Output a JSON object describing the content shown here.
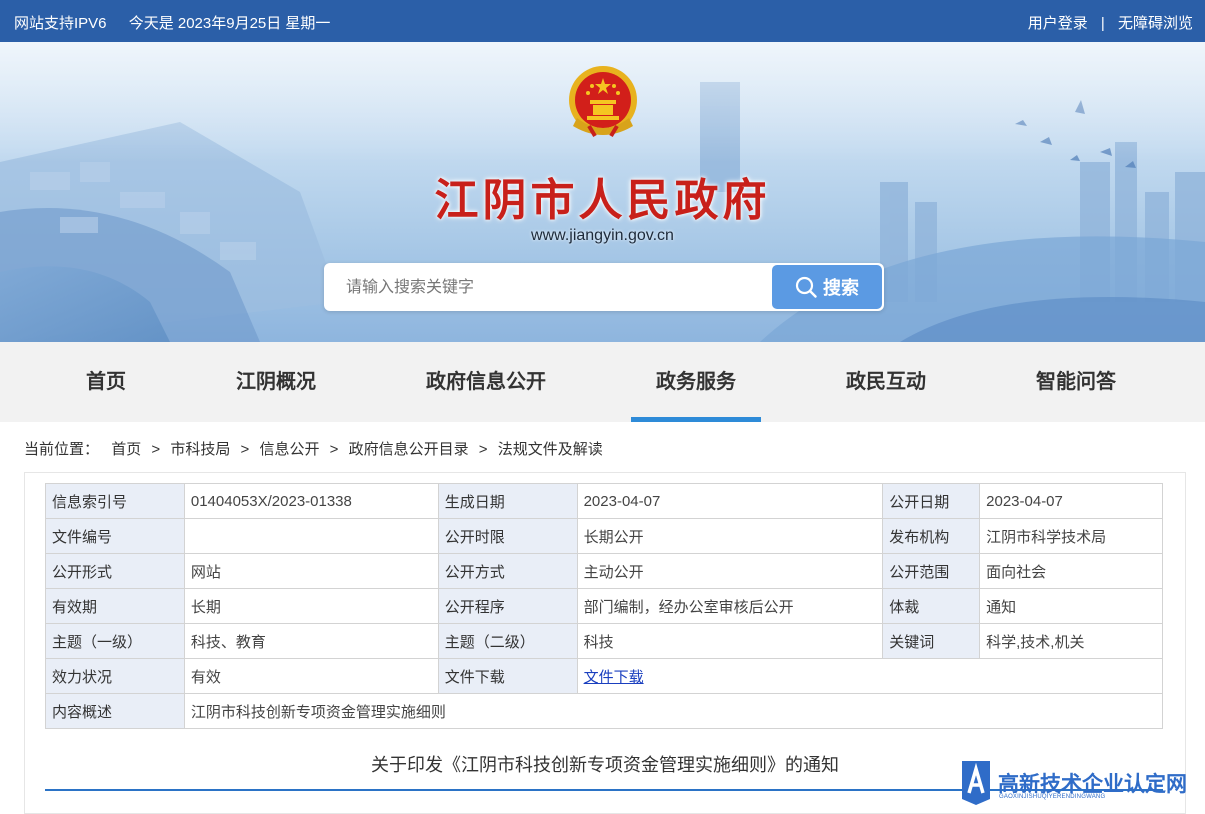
{
  "topbar": {
    "ipv6": "网站支持IPV6",
    "date": "今天是 2023年9月25日 星期一",
    "login": "用户登录",
    "separator": "|",
    "accessibility": "无障碍浏览"
  },
  "header": {
    "title": "江阴市人民政府",
    "url": "www.jiangyin.gov.cn"
  },
  "search": {
    "placeholder": "请输入搜索关键字",
    "button": "搜索"
  },
  "nav": [
    {
      "label": "首页"
    },
    {
      "label": "江阴概况"
    },
    {
      "label": "政府信息公开"
    },
    {
      "label": "政务服务",
      "active": true
    },
    {
      "label": "政民互动"
    },
    {
      "label": "智能问答"
    }
  ],
  "breadcrumb": {
    "prefix": "当前位置：",
    "items": [
      "首页",
      "市科技局",
      "信息公开",
      "政府信息公开目录",
      "法规文件及解读"
    ],
    "separator": ">"
  },
  "meta": {
    "index_no": {
      "label": "信息索引号",
      "value": "01404053X/2023-01338"
    },
    "created": {
      "label": "生成日期",
      "value": "2023-04-07"
    },
    "published": {
      "label": "公开日期",
      "value": "2023-04-07"
    },
    "doc_no": {
      "label": "文件编号",
      "value": ""
    },
    "period": {
      "label": "公开时限",
      "value": "长期公开"
    },
    "issuer": {
      "label": "发布机构",
      "value": "江阴市科学技术局"
    },
    "form": {
      "label": "公开形式",
      "value": "网站"
    },
    "method": {
      "label": "公开方式",
      "value": "主动公开"
    },
    "scope": {
      "label": "公开范围",
      "value": "面向社会"
    },
    "validity": {
      "label": "有效期",
      "value": "长期"
    },
    "procedure": {
      "label": "公开程序",
      "value": "部门编制，经办公室审核后公开"
    },
    "genre": {
      "label": "体裁",
      "value": "通知"
    },
    "topic1": {
      "label": "主题（一级）",
      "value": "科技、教育"
    },
    "topic2": {
      "label": "主题（二级）",
      "value": "科技"
    },
    "keywords": {
      "label": "关键词",
      "value": "科学,技术,机关"
    },
    "status": {
      "label": "效力状况",
      "value": "有效"
    },
    "download": {
      "label": "文件下载",
      "value": "文件下载"
    },
    "summary": {
      "label": "内容概述",
      "value": "江阴市科技创新专项资金管理实施细则"
    }
  },
  "document": {
    "title": "关于印发《江阴市科技创新专项资金管理实施细则》的通知"
  },
  "watermark": {
    "title": "高新技术企业认定网",
    "subtitle": "GAOXINJISHUQIYERENDINGWANG"
  },
  "colors": {
    "topbar": "#2b5fa8",
    "title_red": "#c8201a",
    "nav_active": "#2e8bd8",
    "search_button": "#5b9ae3",
    "table_label_bg": "#e9eef7"
  },
  "icons": {
    "emblem": "national-emblem-icon",
    "search": "search-icon",
    "watermark": "watermark-logo-icon"
  }
}
